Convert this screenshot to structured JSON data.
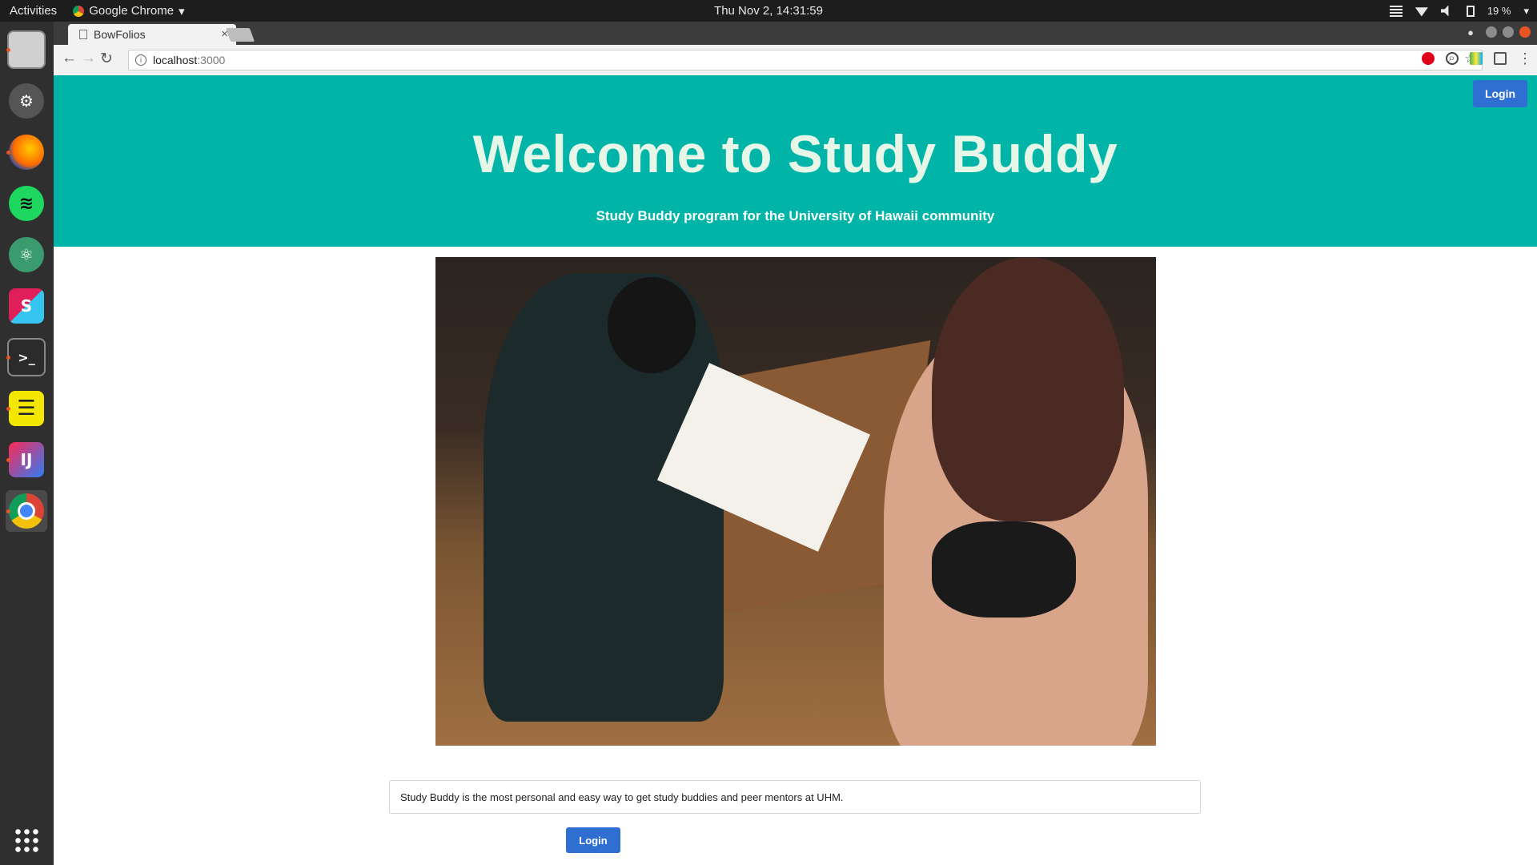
{
  "system_bar": {
    "activities": "Activities",
    "app_name": "Google Chrome",
    "clock": "Thu Nov  2, 14:31:59",
    "battery": "19 %"
  },
  "dock": {
    "items": [
      {
        "name": "files-icon",
        "label": ""
      },
      {
        "name": "settings-icon",
        "label": ""
      },
      {
        "name": "firefox-icon",
        "label": ""
      },
      {
        "name": "spotify-icon",
        "label": ""
      },
      {
        "name": "atom-icon",
        "label": ""
      },
      {
        "name": "slack-icon",
        "label": "S"
      },
      {
        "name": "terminal-icon",
        "label": ">_"
      },
      {
        "name": "notes-icon",
        "label": ""
      },
      {
        "name": "intellij-icon",
        "label": "IJ"
      },
      {
        "name": "chrome-icon",
        "label": ""
      }
    ]
  },
  "browser": {
    "tab_title": "BowFolios",
    "tab_close": "×",
    "url_host": "localhost",
    "url_port": ":3000"
  },
  "page": {
    "header_login": "Login",
    "title": "Welcome to Study Buddy",
    "subtitle": "Study Buddy program for the University of Hawaii community",
    "description": "Study Buddy is the most personal and easy way to get study buddies and peer mentors at UHM.",
    "bottom_login": "Login"
  },
  "colors": {
    "hero_bg": "#00b5a8",
    "title_color": "#e6f7e8",
    "button_blue": "#2f6fd1"
  }
}
